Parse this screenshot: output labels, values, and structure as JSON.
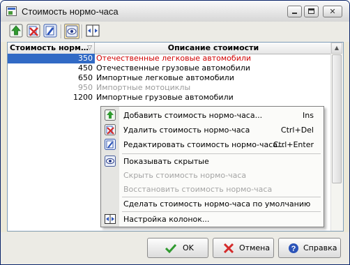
{
  "window": {
    "title": "Стоимость нормо-часа"
  },
  "toolbar": {
    "buttons": [
      {
        "icon": "add-icon"
      },
      {
        "icon": "delete-icon"
      },
      {
        "icon": "edit-icon"
      },
      {
        "icon": "show-hidden-icon",
        "pressed": true
      },
      {
        "icon": "columns-icon"
      }
    ]
  },
  "grid": {
    "columns": [
      "Стоимость норм…",
      "Описание стоимости"
    ],
    "rows": [
      {
        "cost": "350",
        "description": "Отечественные легковые автомобили",
        "state": "selected-default"
      },
      {
        "cost": "450",
        "description": "Отечественные грузовые автомобили",
        "state": "normal"
      },
      {
        "cost": "650",
        "description": "Импортные легковые автомобили",
        "state": "normal"
      },
      {
        "cost": "950",
        "description": "Импортные мотоциклы",
        "state": "hidden"
      },
      {
        "cost": "1200",
        "description": "Импортные грузовые автомобили",
        "state": "normal"
      }
    ]
  },
  "context_menu": {
    "items": [
      {
        "label": "Добавить стоимость нормо-часа...",
        "shortcut": "Ins",
        "icon": "add-icon",
        "enabled": true
      },
      {
        "label": "Удалить стоимость нормо-часа",
        "shortcut": "Ctrl+Del",
        "icon": "delete-icon",
        "enabled": true
      },
      {
        "label": "Редактировать стоимость нормо-часа...",
        "shortcut": "Ctrl+Enter",
        "icon": "edit-icon",
        "enabled": true
      },
      {
        "label": "Показывать скрытые",
        "shortcut": "",
        "icon": "show-hidden-icon",
        "enabled": true,
        "checked": true
      },
      {
        "label": "Скрыть стоимость нормо-часа",
        "shortcut": "",
        "enabled": false
      },
      {
        "label": "Восстановить стоимость нормо-часа",
        "shortcut": "",
        "enabled": false
      },
      {
        "label": "Сделать стоимость нормо-часа по умолчанию",
        "shortcut": "",
        "enabled": true
      },
      {
        "label": "Настройка колонок...",
        "shortcut": "",
        "icon": "columns-icon",
        "enabled": true
      }
    ]
  },
  "footer": {
    "ok": "OK",
    "cancel": "Отмена",
    "help": "Справка"
  },
  "colors": {
    "selection": "#316ac5",
    "default_row_text": "#d00000",
    "hidden_row_text": "#9a9a9a",
    "accent_green": "#2f9a2f",
    "accent_red": "#d42a2a"
  }
}
